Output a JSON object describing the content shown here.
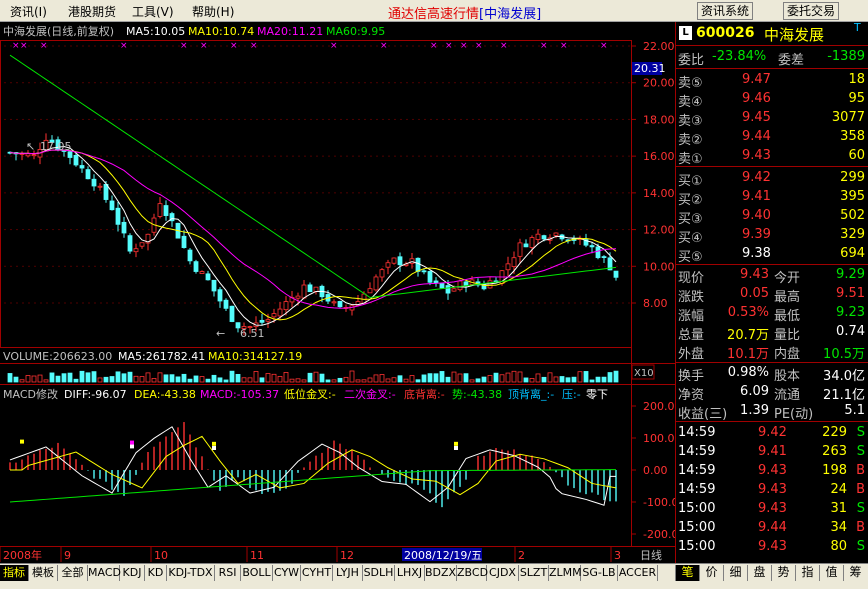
{
  "menu": {
    "items": [
      "资讯(I)",
      "港股期货",
      "工具(V)",
      "帮助(H)"
    ],
    "title": "通达信高速行情",
    "title_sub": "[中海发展]",
    "buttons": [
      "资讯系统",
      "委托交易"
    ]
  },
  "chart": {
    "title_line": "中海发展(日线,前复权)",
    "ma5": "MA5:10.05",
    "ma10": "MA10:10.74",
    "ma20": "MA20:11.21",
    "ma60": "MA60:9.95",
    "price_ticks": [
      "22.00",
      "20.00",
      "18.00",
      "16.00",
      "14.00",
      "12.00",
      "10.00",
      "8.00"
    ],
    "current_tag": "20.31",
    "high_label": "17.05",
    "low_label": "6.51",
    "volume_line": {
      "vol": "VOLUME:206623.00",
      "ma5": "MA5:261782.41",
      "ma10": "MA10:314127.19"
    },
    "x10": "X10",
    "macd_line": {
      "name": "MACD修改",
      "diff": "DIFF:-96.07",
      "dea": "DEA:-43.38",
      "macd": "MACD:-105.37",
      "t1": "低位金叉:-",
      "t2": "二次金叉:-",
      "t3": "底背离:-",
      "t4": "势:-43.38",
      "t5": "顶背离_:-",
      "t6": "压:-",
      "t7": "零下"
    },
    "macd_ticks": [
      "200.00",
      "100.00",
      "0.00",
      "-100.00",
      "-200.00"
    ],
    "dates": [
      "2008年",
      "9",
      "10",
      "11",
      "12",
      "2008/12/19/五",
      "2",
      "3"
    ],
    "period": "日线"
  },
  "quote": {
    "code": "600026",
    "name": "中海发展",
    "badge": "L",
    "t_mark": "T",
    "weibi_label": "委比",
    "weibi": "-23.84%",
    "weicha_label": "委差",
    "weicha": "-1389",
    "sell": [
      {
        "label": "卖⑤",
        "price": "9.47",
        "vol": "18"
      },
      {
        "label": "卖④",
        "price": "9.46",
        "vol": "95"
      },
      {
        "label": "卖③",
        "price": "9.45",
        "vol": "3077"
      },
      {
        "label": "卖②",
        "price": "9.44",
        "vol": "358"
      },
      {
        "label": "卖①",
        "price": "9.43",
        "vol": "60"
      }
    ],
    "buy": [
      {
        "label": "买①",
        "price": "9.42",
        "vol": "299"
      },
      {
        "label": "买②",
        "price": "9.41",
        "vol": "395"
      },
      {
        "label": "买③",
        "price": "9.40",
        "vol": "502"
      },
      {
        "label": "买④",
        "price": "9.39",
        "vol": "329"
      },
      {
        "label": "买⑤",
        "price": "9.38",
        "vol": "694"
      }
    ],
    "stats": [
      {
        "l1": "现价",
        "v1": "9.43",
        "c1": "red",
        "l2": "今开",
        "v2": "9.29",
        "c2": "green"
      },
      {
        "l1": "涨跌",
        "v1": "0.05",
        "c1": "red",
        "l2": "最高",
        "v2": "9.51",
        "c2": "red"
      },
      {
        "l1": "涨幅",
        "v1": "0.53%",
        "c1": "red",
        "l2": "最低",
        "v2": "9.23",
        "c2": "green"
      },
      {
        "l1": "总量",
        "v1": "20.7万",
        "c1": "yellow",
        "l2": "量比",
        "v2": "0.74",
        "c2": "white"
      },
      {
        "l1": "外盘",
        "v1": "10.1万",
        "c1": "red",
        "l2": "内盘",
        "v2": "10.5万",
        "c2": "green"
      }
    ],
    "info": [
      {
        "l1": "换手",
        "v1": "0.98%",
        "l2": "股本",
        "v2": "34.0亿"
      },
      {
        "l1": "净资",
        "v1": "6.09",
        "l2": "流通",
        "v2": "21.1亿"
      },
      {
        "l1": "收益(三)",
        "v1": "1.39",
        "l2": "PE(动)",
        "v2": "5.1"
      }
    ],
    "ticks": [
      {
        "time": "14:59",
        "price": "9.42",
        "vol": "229",
        "side": "S"
      },
      {
        "time": "14:59",
        "price": "9.41",
        "vol": "263",
        "side": "S"
      },
      {
        "time": "14:59",
        "price": "9.43",
        "vol": "198",
        "side": "B"
      },
      {
        "time": "14:59",
        "price": "9.43",
        "vol": "24",
        "side": "B"
      },
      {
        "time": "15:00",
        "price": "9.43",
        "vol": "31",
        "side": "S"
      },
      {
        "time": "15:00",
        "price": "9.44",
        "vol": "34",
        "side": "B"
      },
      {
        "time": "15:00",
        "price": "9.43",
        "vol": "80",
        "side": "S"
      }
    ]
  },
  "tabs": {
    "indicator_tabs": [
      "指标",
      "模板",
      "全部",
      "MACD",
      "KDJ",
      "KD",
      "KDJ-TDX",
      "RSI",
      "BOLL",
      "CYW",
      "CYHT",
      "LYJH",
      "SDLH",
      "LHXJ",
      "BDZX",
      "ZBCD",
      "CJDX",
      "SLZT",
      "ZLMM",
      "SG-LB",
      "ACCER"
    ],
    "panel_tabs": [
      "笔",
      "价",
      "细",
      "盘",
      "势",
      "指",
      "值",
      "筹"
    ]
  },
  "colors": {
    "up": "#ff3232",
    "down": "#54fcfc",
    "ma5": "#ffffff",
    "ma10": "#ffff00",
    "ma20": "#ff00ff",
    "ma60": "#00e600"
  }
}
